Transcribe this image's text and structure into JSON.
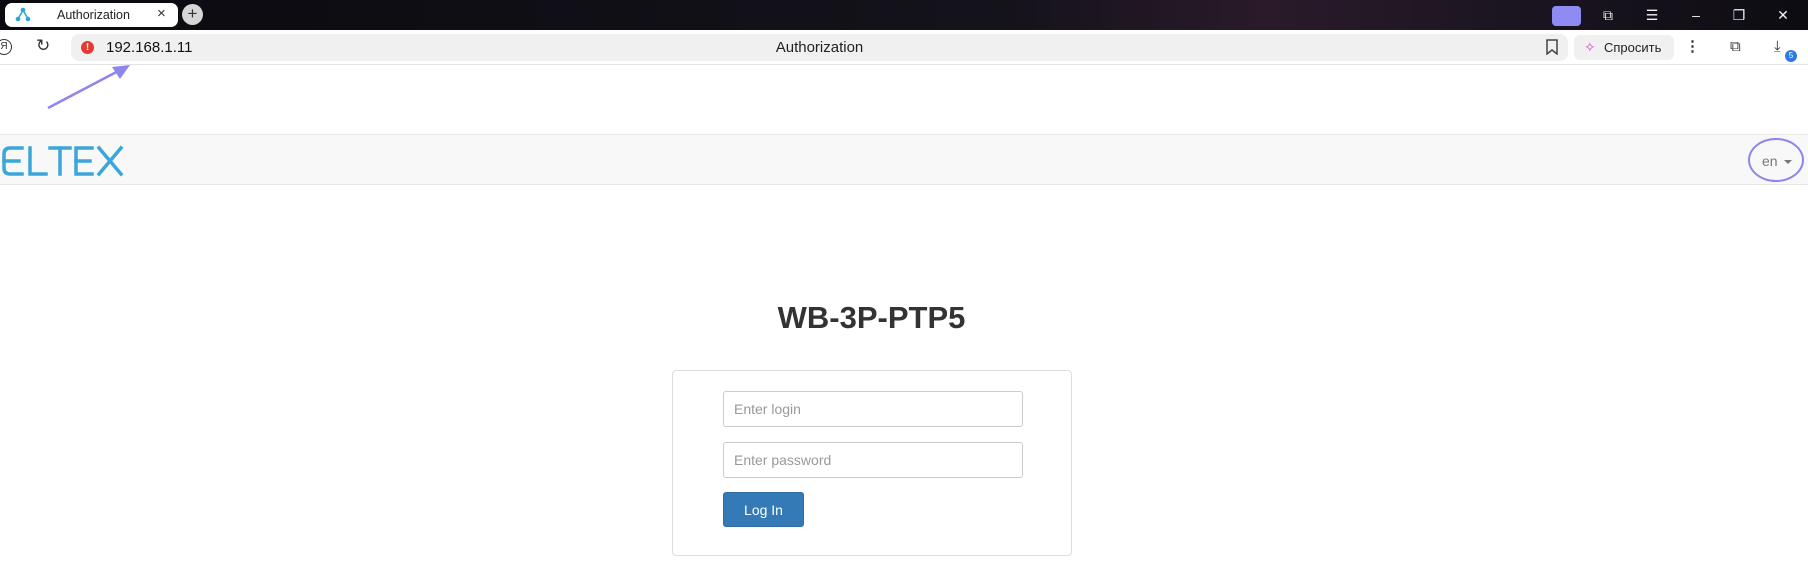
{
  "browser": {
    "tab": {
      "title": "Authorization",
      "close": "×"
    },
    "new_tab": "+",
    "address": {
      "url": "192.168.1.11",
      "page_title": "Authorization"
    },
    "ask_button": {
      "label": "Спросить"
    },
    "downloads_badge": "5",
    "icons": [
      "yandex-back-icon",
      "reload-icon",
      "security-warning-icon",
      "bookmark-icon",
      "ask-alice-icon",
      "menu-dots-icon",
      "collections-icon",
      "downloads-icon",
      "window-minimize-icon",
      "window-restore-icon",
      "window-close-icon",
      "hamburger-menu-icon",
      "bookmarks-panel-icon"
    ]
  },
  "colors": {
    "accent": "#337ab7",
    "logo": "#3ba6d9",
    "annotation": "#8e85ee",
    "warning": "#e53935"
  },
  "navbar": {
    "logo_text": "ELTEX",
    "language": "en"
  },
  "login": {
    "device_name": "WB-3P-PTP5",
    "login_placeholder": "Enter login",
    "password_placeholder": "Enter password",
    "button_label": "Log In"
  }
}
